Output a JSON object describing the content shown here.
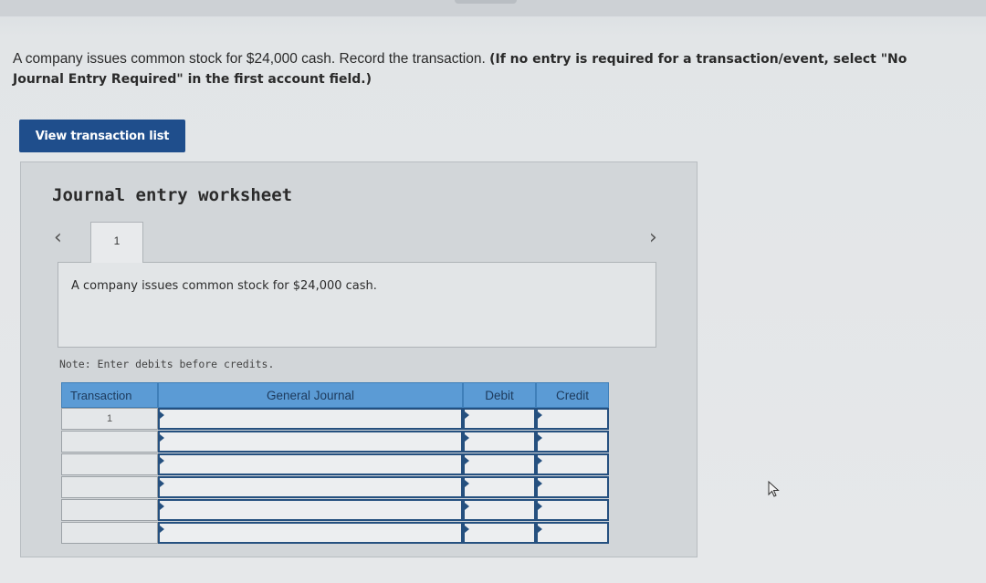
{
  "question": {
    "text": "A company issues common stock for $24,000 cash. Record the transaction. ",
    "instruction": "(If no entry is required for a transaction/event, select \"No Journal Entry Required\" in the first account field.)"
  },
  "view_button": "View transaction list",
  "worksheet": {
    "title": "Journal entry worksheet",
    "prev_icon": "chevron-left-icon",
    "next_icon": "chevron-right-icon",
    "tab_label": "1",
    "description": "A company issues common stock for $24,000 cash.",
    "note": "Note: Enter debits before credits."
  },
  "table": {
    "headers": {
      "transaction": "Transaction",
      "general_journal": "General Journal",
      "debit": "Debit",
      "credit": "Credit"
    },
    "rows": [
      {
        "transaction": "1",
        "general_journal": "",
        "debit": "",
        "credit": ""
      },
      {
        "transaction": "",
        "general_journal": "",
        "debit": "",
        "credit": ""
      },
      {
        "transaction": "",
        "general_journal": "",
        "debit": "",
        "credit": ""
      },
      {
        "transaction": "",
        "general_journal": "",
        "debit": "",
        "credit": ""
      },
      {
        "transaction": "",
        "general_journal": "",
        "debit": "",
        "credit": ""
      },
      {
        "transaction": "",
        "general_journal": "",
        "debit": "",
        "credit": ""
      }
    ]
  },
  "colors": {
    "button": "#1f4e8c",
    "header": "#5b9bd5",
    "input_border": "#25507f"
  }
}
